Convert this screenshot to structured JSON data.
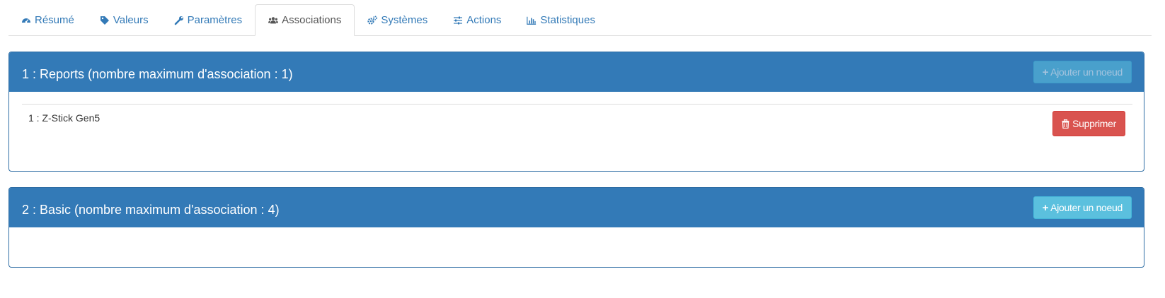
{
  "tabs": [
    {
      "label": "Résumé",
      "icon": "dashboard-icon",
      "active": false
    },
    {
      "label": "Valeurs",
      "icon": "tag-icon",
      "active": false
    },
    {
      "label": "Paramètres",
      "icon": "wrench-icon",
      "active": false
    },
    {
      "label": "Associations",
      "icon": "users-icon",
      "active": true
    },
    {
      "label": "Systèmes",
      "icon": "cogs-icon",
      "active": false
    },
    {
      "label": "Actions",
      "icon": "sliders-icon",
      "active": false
    },
    {
      "label": "Statistiques",
      "icon": "bar-chart-icon",
      "active": false
    }
  ],
  "groups": [
    {
      "title": "1 : Reports (nombre maximum d'association : 1)",
      "add_label": "Ajouter un noeud",
      "add_disabled": true,
      "items": [
        {
          "label": "1 : Z-Stick Gen5",
          "delete_label": "Supprimer"
        }
      ]
    },
    {
      "title": "2 : Basic (nombre maximum d'association : 4)",
      "add_label": "Ajouter un noeud",
      "add_disabled": false,
      "items": []
    }
  ],
  "colors": {
    "primary": "#337ab7",
    "info": "#5bc0de",
    "danger": "#d9534f",
    "link": "#337ab7"
  }
}
